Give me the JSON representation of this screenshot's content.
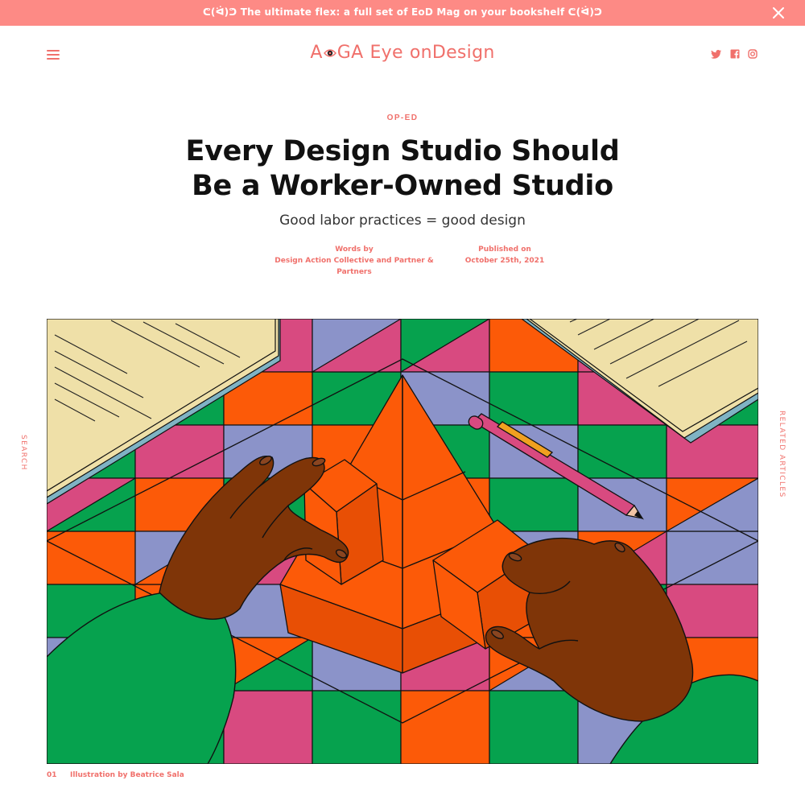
{
  "banner": {
    "text": "ᕦ(ᐛ)ᕤ The ultimate flex: a full set of EoD Mag on your bookshelf ᕦ(ᐛ)ᕤ",
    "close_icon": "close-icon"
  },
  "header": {
    "menu_icon": "hamburger-menu-icon",
    "logo": {
      "part1": "A",
      "part2": "GA",
      "part3": "Eye",
      "part4": "on",
      "part5": "Design"
    },
    "social_icons": [
      "twitter-icon",
      "facebook-icon",
      "instagram-icon"
    ]
  },
  "article": {
    "category": "OP-ED",
    "title": "Every Design Studio Should Be a Worker-Owned Studio",
    "subtitle": "Good labor practices = good design",
    "words_by_label": "Words by",
    "authors": "Design Action Collective and Partner & Partners",
    "published_label": "Published on",
    "published_date": "October 25th, 2021"
  },
  "side": {
    "search": "SEARCH",
    "related": "RELATED ARTICLES"
  },
  "hero": {
    "caption_number": "01",
    "caption": "Illustration by Beatrice Sala"
  },
  "colors": {
    "accent": "#f0706b",
    "banner": "#fd8a85",
    "orange": "#fc5a08",
    "green": "#06a24e",
    "lavender": "#8b93c9",
    "pink": "#d84a80",
    "skin": "#7f3508",
    "paper": "#efe0a8"
  }
}
